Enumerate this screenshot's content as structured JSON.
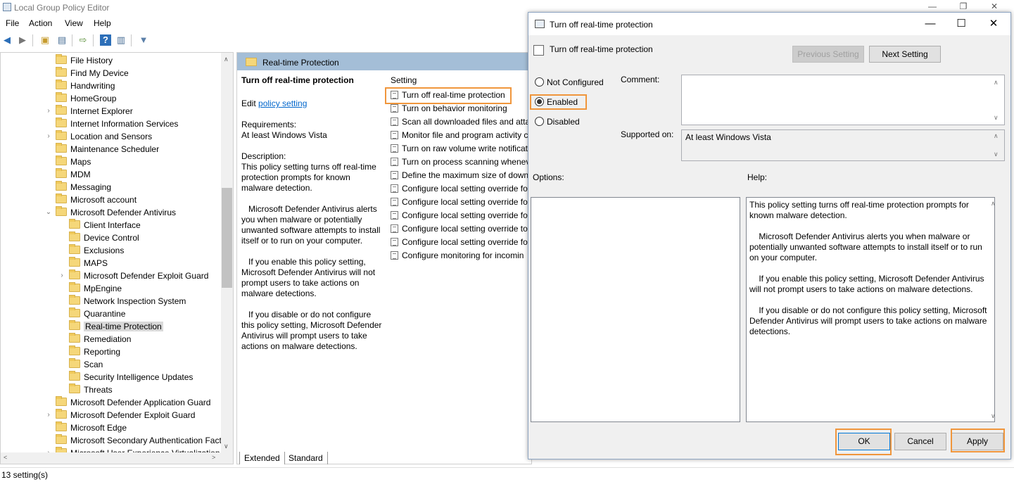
{
  "main_window": {
    "title": "Local Group Policy Editor",
    "controls": {
      "minimize": "—",
      "restore": "❐",
      "close": "✕"
    }
  },
  "menu": [
    "File",
    "Action",
    "View",
    "Help"
  ],
  "tree": {
    "items": [
      {
        "label": "File History",
        "indent": 0,
        "arrow": ""
      },
      {
        "label": "Find My Device",
        "indent": 0,
        "arrow": ""
      },
      {
        "label": "Handwriting",
        "indent": 0,
        "arrow": ""
      },
      {
        "label": "HomeGroup",
        "indent": 0,
        "arrow": ""
      },
      {
        "label": "Internet Explorer",
        "indent": 0,
        "arrow": ">"
      },
      {
        "label": "Internet Information Services",
        "indent": 0,
        "arrow": ""
      },
      {
        "label": "Location and Sensors",
        "indent": 0,
        "arrow": ">"
      },
      {
        "label": "Maintenance Scheduler",
        "indent": 0,
        "arrow": ""
      },
      {
        "label": "Maps",
        "indent": 0,
        "arrow": ""
      },
      {
        "label": "MDM",
        "indent": 0,
        "arrow": ""
      },
      {
        "label": "Messaging",
        "indent": 0,
        "arrow": ""
      },
      {
        "label": "Microsoft account",
        "indent": 0,
        "arrow": ""
      },
      {
        "label": "Microsoft Defender Antivirus",
        "indent": 0,
        "arrow": "v"
      },
      {
        "label": "Client Interface",
        "indent": 1,
        "arrow": ""
      },
      {
        "label": "Device Control",
        "indent": 1,
        "arrow": ""
      },
      {
        "label": "Exclusions",
        "indent": 1,
        "arrow": ""
      },
      {
        "label": "MAPS",
        "indent": 1,
        "arrow": ""
      },
      {
        "label": "Microsoft Defender Exploit Guard",
        "indent": 1,
        "arrow": ">"
      },
      {
        "label": "MpEngine",
        "indent": 1,
        "arrow": ""
      },
      {
        "label": "Network Inspection System",
        "indent": 1,
        "arrow": ""
      },
      {
        "label": "Quarantine",
        "indent": 1,
        "arrow": ""
      },
      {
        "label": "Real-time Protection",
        "indent": 1,
        "arrow": "",
        "selected": true
      },
      {
        "label": "Remediation",
        "indent": 1,
        "arrow": ""
      },
      {
        "label": "Reporting",
        "indent": 1,
        "arrow": ""
      },
      {
        "label": "Scan",
        "indent": 1,
        "arrow": ""
      },
      {
        "label": "Security Intelligence Updates",
        "indent": 1,
        "arrow": ""
      },
      {
        "label": "Threats",
        "indent": 1,
        "arrow": ""
      },
      {
        "label": "Microsoft Defender Application Guard",
        "indent": 0,
        "arrow": ""
      },
      {
        "label": "Microsoft Defender Exploit Guard",
        "indent": 0,
        "arrow": ">"
      },
      {
        "label": "Microsoft Edge",
        "indent": 0,
        "arrow": ""
      },
      {
        "label": "Microsoft Secondary Authentication Fact",
        "indent": 0,
        "arrow": ""
      },
      {
        "label": "Microsoft User Experience Virtualization",
        "indent": 0,
        "arrow": ">"
      }
    ]
  },
  "content": {
    "header_title": "Real-time Protection",
    "policy_title": "Turn off real-time protection",
    "edit_prefix": "Edit ",
    "edit_link": "policy setting",
    "requirements_label": "Requirements:",
    "requirements_value": "At least Windows Vista",
    "description_label": "Description:",
    "description_p1": "This policy setting turns off real-time protection prompts for known malware detection.",
    "description_p2": "Microsoft Defender Antivirus alerts you when malware or potentially unwanted software attempts to install itself or to run on your computer.",
    "description_p3": "If you enable this policy setting, Microsoft Defender Antivirus will not prompt users to take actions on malware detections.",
    "description_p4": "If you disable or do not configure this policy setting, Microsoft Defender Antivirus will prompt users to take actions on malware detections.",
    "setting_column": "Setting",
    "settings": [
      "Turn off real-time protection",
      "Turn on behavior monitoring",
      "Scan all downloaded files and atta",
      "Monitor file and program activity c",
      "Turn on raw volume write notificat",
      "Turn on process scanning whenev",
      "Define the maximum size of down",
      "Configure local setting override fo",
      "Configure local setting override fo",
      "Configure local setting override fo",
      "Configure local setting override to",
      "Configure local setting override fo",
      "Configure monitoring for incomin"
    ]
  },
  "tabs": {
    "extended": "Extended",
    "standard": "Standard"
  },
  "status": {
    "text": "13 setting(s)"
  },
  "dialog": {
    "title": "Turn off real-time protection",
    "policy_name": "Turn off real-time protection",
    "prev_button": "Previous Setting",
    "next_button": "Next Setting",
    "radio_not_configured": "Not Configured",
    "radio_enabled": "Enabled",
    "radio_disabled": "Disabled",
    "selected_option": "Enabled",
    "comment_label": "Comment:",
    "comment_value": "",
    "supported_label": "Supported on:",
    "supported_value": "At least Windows Vista",
    "options_label": "Options:",
    "help_label": "Help:",
    "help_p1": "This policy setting turns off real-time protection prompts for known malware detection.",
    "help_p2": "    Microsoft Defender Antivirus alerts you when malware or potentially unwanted software attempts to install itself or to run on your computer.",
    "help_p3": "    If you enable this policy setting, Microsoft Defender Antivirus will not prompt users to take actions on malware detections.",
    "help_p4": "    If you disable or do not configure this policy setting, Microsoft Defender Antivirus will prompt users to take actions on malware detections.",
    "ok_button": "OK",
    "cancel_button": "Cancel",
    "apply_button": "Apply",
    "controls": {
      "minimize": "—",
      "maximize": "☐",
      "close": "✕"
    }
  },
  "colors": {
    "highlight": "#f0963c",
    "pane_header": "#a4bed7",
    "link": "#0066cc"
  }
}
